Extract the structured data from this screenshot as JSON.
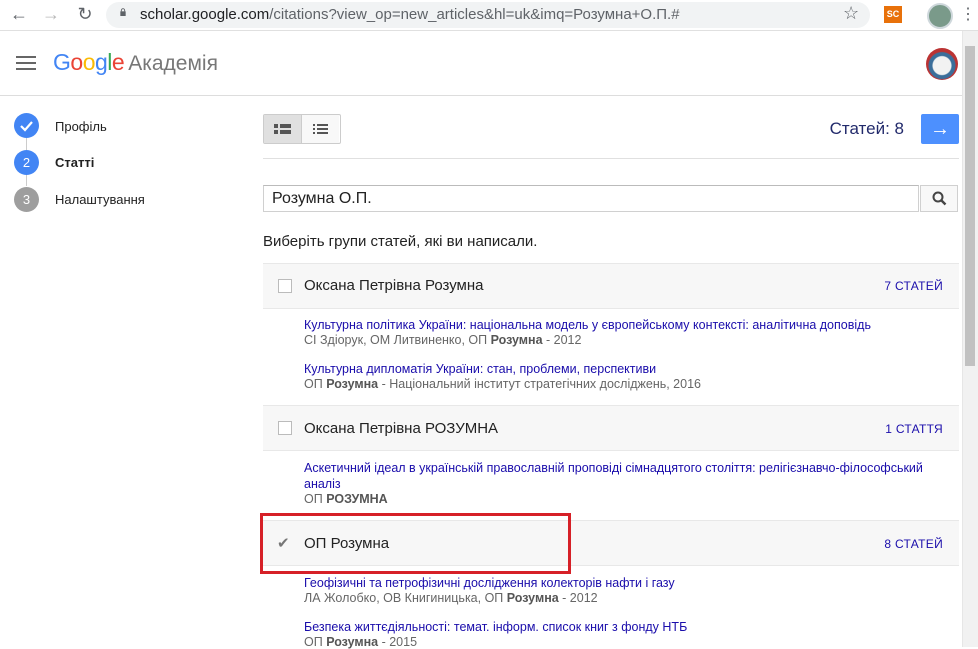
{
  "browser": {
    "url_host": "scholar.google.com",
    "url_rest": "/citations?view_op=new_articles&hl=uk&imq=Розумна+О.П.#",
    "extension_label": "SC"
  },
  "header": {
    "logo_google": "Google",
    "logo_product": "Академія"
  },
  "steps": [
    {
      "num": "",
      "label": "Профіль",
      "state": "done"
    },
    {
      "num": "2",
      "label": "Статті",
      "state": "active"
    },
    {
      "num": "3",
      "label": "Налаштування",
      "state": "pending"
    }
  ],
  "toolbar": {
    "count_label": "Статей: 8",
    "next_icon": "→"
  },
  "search": {
    "value": "Розумна О.П."
  },
  "prompt": "Виберіть групи статей, які ви написали.",
  "groups": [
    {
      "name": "Оксана Петрівна Розумна",
      "count": "7 СТАТЕЙ",
      "checked": false,
      "articles": [
        {
          "title": "Культурна політика України: національна модель у європейському контексті: аналітична доповідь",
          "authors_pre": "СІ Здіорук, ОМ Литвиненко, ОП ",
          "authors_bold": "Розумна",
          "authors_post": " - 2012"
        },
        {
          "title": "Культурна дипломатія України: стан, проблеми, перспективи",
          "authors_pre": "ОП ",
          "authors_bold": "Розумна",
          "authors_post": " - Національний інститут стратегічних досліджень, 2016"
        }
      ]
    },
    {
      "name": "Оксана Петрівна РОЗУМНА",
      "count": "1 СТАТТЯ",
      "checked": false,
      "articles": [
        {
          "title": "Аскетичний ідеал в українській православній проповіді сімнадцятого століття: релігієзнавчо-філософський аналіз",
          "authors_pre": "ОП ",
          "authors_bold": "РОЗУМНА",
          "authors_post": ""
        }
      ]
    },
    {
      "name": "ОП Розумна",
      "count": "8 СТАТЕЙ",
      "checked": true,
      "articles": [
        {
          "title": "Геофізичні та петрофізичні дослідження колекторів нафти і газу",
          "authors_pre": "ЛА Жолобко, ОВ Книгиницька, ОП ",
          "authors_bold": "Розумна",
          "authors_post": " - 2012"
        },
        {
          "title": "Безпека життєдіяльності: темат. інформ. список книг з фонду НТБ",
          "authors_pre": "ОП ",
          "authors_bold": "Розумна",
          "authors_post": " - 2015"
        }
      ]
    }
  ],
  "colors": {
    "step_blue": "#4285f4",
    "step_grey": "#9e9e9e",
    "link_blue": "#1a0dab",
    "highlight_red": "#d62027",
    "button_blue": "#4d90fe"
  }
}
